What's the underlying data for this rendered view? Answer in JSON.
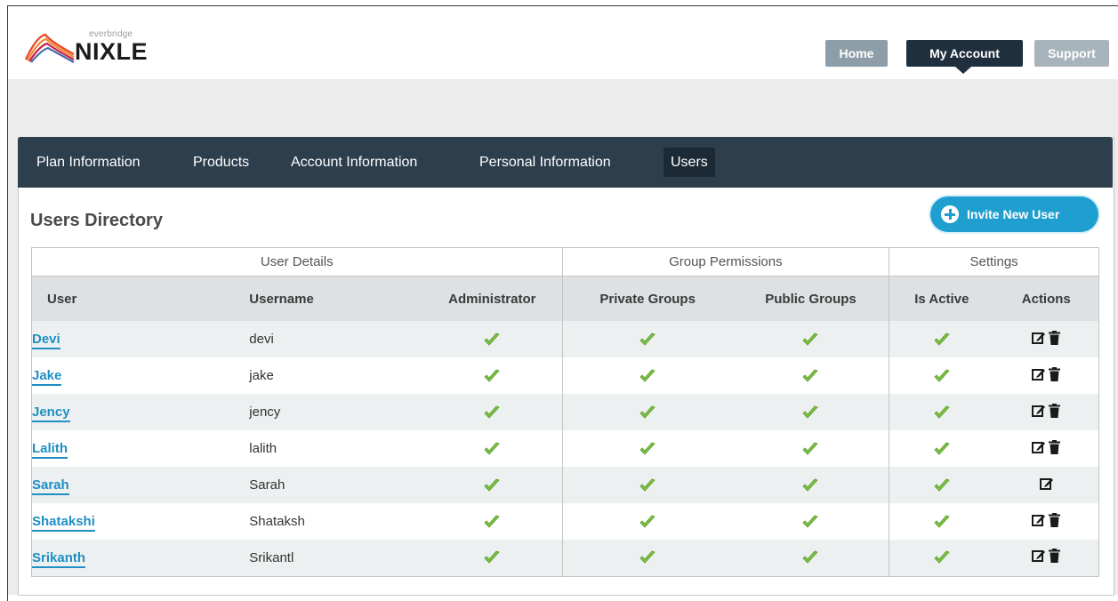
{
  "logo": {
    "sub": "everbridge",
    "main": "NIXLE"
  },
  "topnav": {
    "home": "Home",
    "my_account": "My Account",
    "support": "Support"
  },
  "tabs": [
    {
      "label": "Plan Information"
    },
    {
      "label": "Products"
    },
    {
      "label": "Account Information"
    },
    {
      "label": "Personal Information"
    },
    {
      "label": "Users",
      "active": true
    }
  ],
  "section": {
    "title": "Users Directory",
    "invite_label": "Invite New User"
  },
  "table": {
    "groups": [
      "User Details",
      "Group Permissions",
      "Settings"
    ],
    "columns": [
      "User",
      "Username",
      "Administrator",
      "Private Groups",
      "Public Groups",
      "Is Active",
      "Actions"
    ],
    "rows": [
      {
        "user": "Devi",
        "username": "devi",
        "admin": true,
        "private": true,
        "public": true,
        "active": true,
        "edit": true,
        "delete": true
      },
      {
        "user": "Jake",
        "username": "jake",
        "admin": true,
        "private": true,
        "public": true,
        "active": true,
        "edit": true,
        "delete": true
      },
      {
        "user": "Jency",
        "username": "jency",
        "admin": true,
        "private": true,
        "public": true,
        "active": true,
        "edit": true,
        "delete": true
      },
      {
        "user": "Lalith",
        "username": "lalith",
        "admin": true,
        "private": true,
        "public": true,
        "active": true,
        "edit": true,
        "delete": true
      },
      {
        "user": "Sarah",
        "username": "Sarah",
        "admin": true,
        "private": true,
        "public": true,
        "active": true,
        "edit": true,
        "delete": false
      },
      {
        "user": "Shatakshi",
        "username": "Shataksh",
        "admin": true,
        "private": true,
        "public": true,
        "active": true,
        "edit": true,
        "delete": true
      },
      {
        "user": "Srikanth",
        "username": "Srikantl",
        "admin": true,
        "private": true,
        "public": true,
        "active": true,
        "edit": true,
        "delete": true
      }
    ]
  },
  "colors": {
    "nav_dark": "#2d3e4d",
    "accent_blue": "#1f9fd0",
    "link_blue": "#1f8fc4",
    "check_green": "#7ac143"
  },
  "icons": {
    "check": "checkmark-icon",
    "edit": "edit-icon",
    "delete": "trash-icon",
    "plus": "plus-circle-icon"
  }
}
